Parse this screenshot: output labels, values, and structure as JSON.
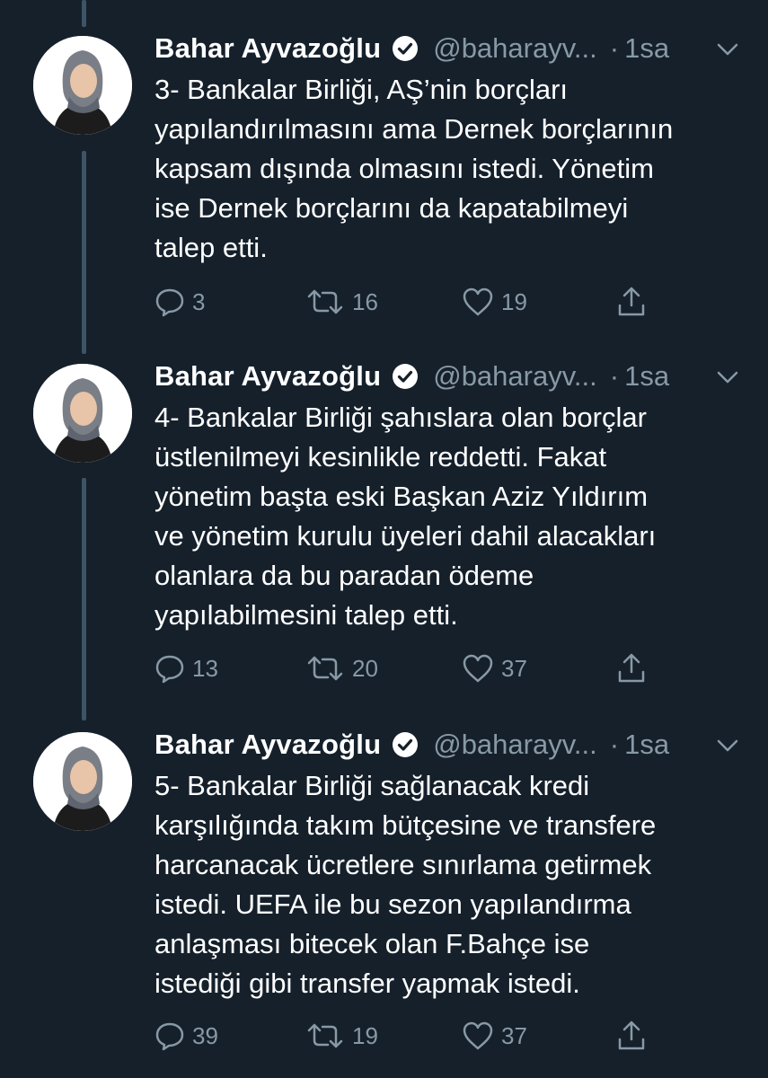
{
  "author": {
    "name": "Bahar Ayvazoğlu",
    "handle": "@baharayv...",
    "separator": "·",
    "time": "1sa"
  },
  "icons": {
    "verified": "verified-badge-icon",
    "caret": "chevron-down-icon",
    "reply": "reply-icon",
    "retweet": "retweet-icon",
    "like": "heart-icon",
    "share": "share-icon"
  },
  "colors": {
    "background": "#15202b",
    "text": "#ffffff",
    "muted": "#8899a6",
    "thread_line": "#3d5466"
  },
  "tweets": [
    {
      "text": "3- Bankalar Birliği, AŞ’nin borçları\nyapılandırılmasını ama Dernek borçlarının\nkapsam dışında olmasını istedi. Yönetim\nise Dernek borçlarını da kapatabilmeyi\ntalep etti.",
      "replies": "3",
      "retweets": "16",
      "likes": "19"
    },
    {
      "text": "4- Bankalar Birliği şahıslara olan borçlar\nüstlenilmeyi kesinlikle reddetti. Fakat\nyönetim başta eski Başkan Aziz Yıldırım\nve yönetim kurulu üyeleri dahil alacakları\nolanlara da bu paradan ödeme\nyapılabilmesini talep etti.",
      "replies": "13",
      "retweets": "20",
      "likes": "37"
    },
    {
      "text": "5- Bankalar Birliği sağlanacak kredi\nkarşılığında takım bütçesine ve transfere\nharcanacak ücretlere sınırlama getirmek\nistedi. UEFA ile bu sezon yapılandırma\nanlaşması bitecek olan F.Bahçe ise\nistediği gibi transfer yapmak istedi.",
      "replies": "39",
      "retweets": "19",
      "likes": "37"
    }
  ]
}
